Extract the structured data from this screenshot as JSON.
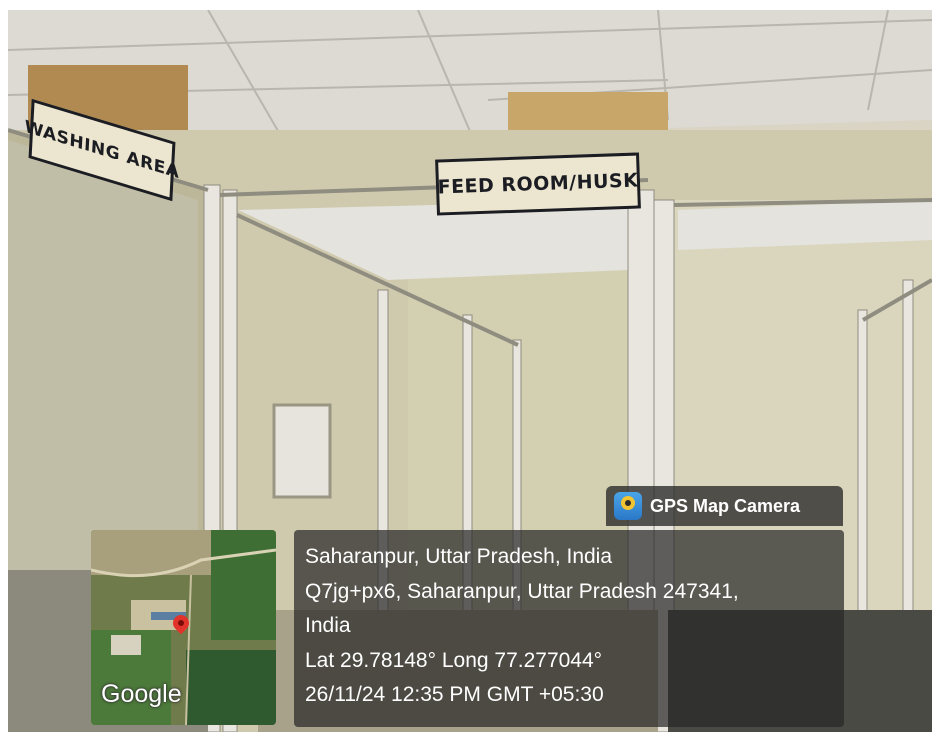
{
  "signs": {
    "washing": "WASHING AREA",
    "feed": "FEED ROOM/HUSK"
  },
  "overlay": {
    "app_name": "GPS Map Camera",
    "icon": "gps-camera-icon",
    "map_logo": "Google",
    "map_pin": "location-pin-icon"
  },
  "location": {
    "city_line": "Saharanpur, Uttar Pradesh, India",
    "address_line1": "Q7jg+px6, Saharanpur, Uttar Pradesh 247341,",
    "address_line2": "India",
    "coords": "Lat 29.78148° Long 77.277044°",
    "timestamp": "26/11/24 12:35 PM GMT +05:30"
  },
  "colors": {
    "sign_bg": "#ece5cf",
    "overlay_bg": "#282828",
    "pin": "#e2332b"
  }
}
